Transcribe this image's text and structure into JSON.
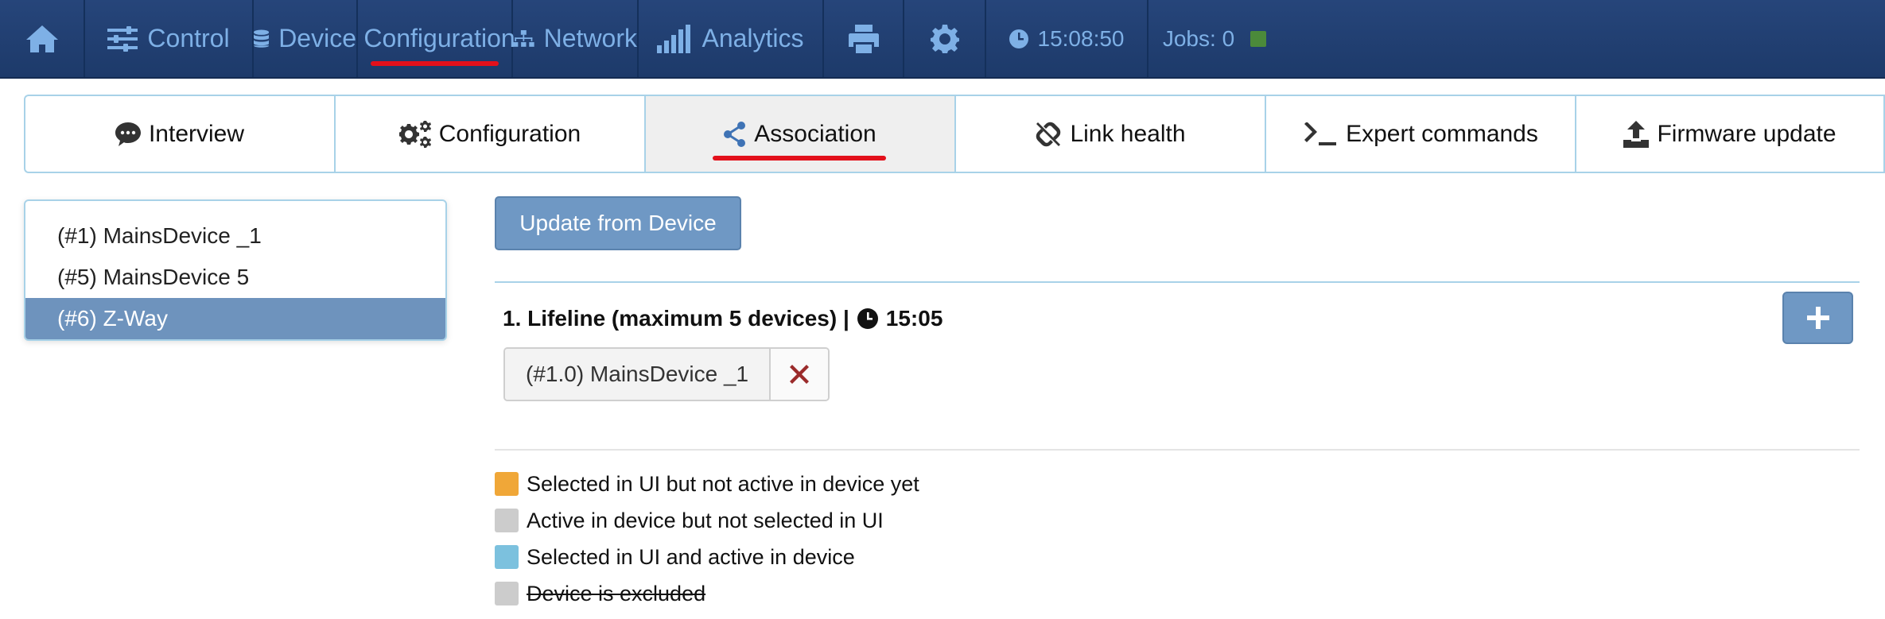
{
  "topnav": {
    "items": [
      {
        "label": "",
        "icon": "home-icon"
      },
      {
        "label": "Control",
        "icon": "sliders-icon"
      },
      {
        "label": "Device",
        "icon": "database-icon"
      },
      {
        "label": "Configuration",
        "icon": "wrench-icon",
        "active": true
      },
      {
        "label": "Network",
        "icon": "sitemap-icon"
      },
      {
        "label": "Analytics",
        "icon": "signal-bars-icon"
      },
      {
        "label": "",
        "icon": "print-icon"
      },
      {
        "label": "",
        "icon": "gear-icon"
      }
    ],
    "clock": "15:08:50",
    "jobs": "Jobs: 0",
    "jobs_status_color": "#4b8a3a",
    "active_underline_color": "#e3101b"
  },
  "subtabs": [
    {
      "label": "Interview",
      "icon": "comment-icon"
    },
    {
      "label": "Configuration",
      "icon": "gears-icon"
    },
    {
      "label": "Association",
      "icon": "share-icon",
      "active": true
    },
    {
      "label": "Link health",
      "icon": "unlink-icon"
    },
    {
      "label": "Expert commands",
      "icon": "terminal-icon"
    },
    {
      "label": "Firmware update",
      "icon": "upload-icon"
    }
  ],
  "device_list": {
    "items": [
      {
        "label": "(#1) MainsDevice _1"
      },
      {
        "label": "(#5) MainsDevice 5"
      },
      {
        "label": "(#6) Z-Way",
        "selected": true
      }
    ]
  },
  "main": {
    "update_button": "Update from Device",
    "group_title": "1. Lifeline (maximum 5 devices) |",
    "group_time": "15:05",
    "association_chip": "(#1.0) MainsDevice _1",
    "legend": [
      {
        "label": "Selected in UI but not active in device yet",
        "color": "#f0a738"
      },
      {
        "label": "Active in device but not selected in UI",
        "color": "#cccccc"
      },
      {
        "label": "Selected in UI and active in device",
        "color": "#7cc1de"
      },
      {
        "label": "Device is excluded",
        "color": "#cccccc",
        "strikethrough": true
      }
    ]
  }
}
